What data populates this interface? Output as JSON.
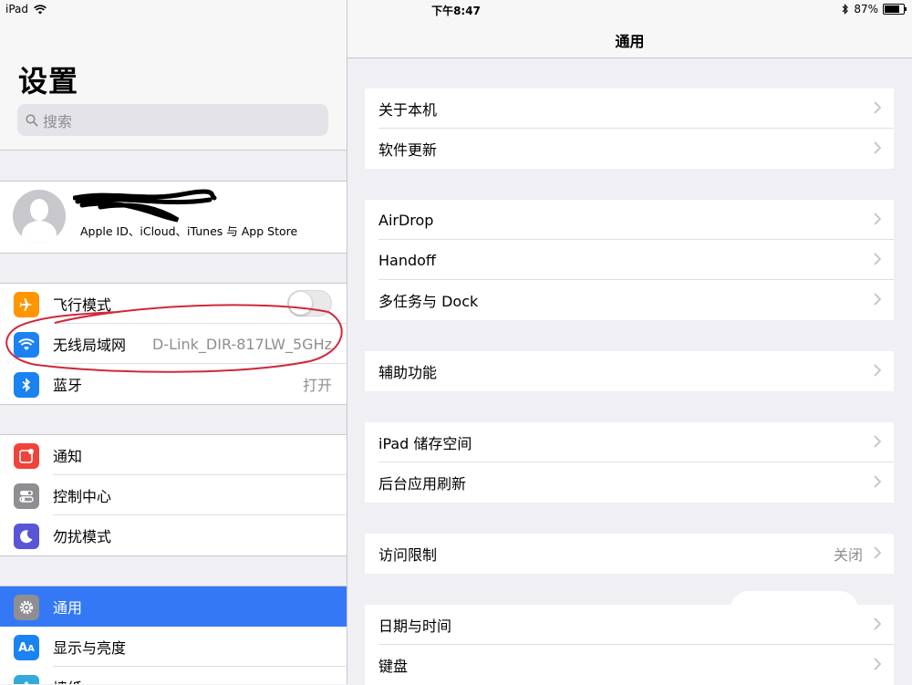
{
  "status": {
    "device": "iPad",
    "time": "下午8:47",
    "battery": "87%",
    "battery_level": 0.87
  },
  "left": {
    "title": "设置",
    "search_placeholder": "搜索",
    "profile_subtitle": "Apple ID、iCloud、iTunes 与 App Store",
    "group1": [
      {
        "label": "飞行模式",
        "value": "",
        "icon": "airplane-icon",
        "color": "#ff9500",
        "toggle": false
      },
      {
        "label": "无线局域网",
        "value": "D-Link_DIR-817LW_5GHz",
        "icon": "wifi-icon",
        "color": "#1b82f2"
      },
      {
        "label": "蓝牙",
        "value": "打开",
        "icon": "bluetooth-icon",
        "color": "#1b82f2"
      }
    ],
    "group2": [
      {
        "label": "通知",
        "icon": "notification-icon",
        "color": "#f0433a"
      },
      {
        "label": "控制中心",
        "icon": "control-center-icon",
        "color": "#8e8e93"
      },
      {
        "label": "勿扰模式",
        "icon": "moon-icon",
        "color": "#5856d6"
      }
    ],
    "group3": [
      {
        "label": "通用",
        "icon": "gear-icon",
        "color": "#8e8e93",
        "selected": true
      },
      {
        "label": "显示与亮度",
        "icon": "display-icon",
        "color": "#1b82f2"
      },
      {
        "label": "墙纸",
        "icon": "wallpaper-icon",
        "color": "#34aadc"
      }
    ]
  },
  "right": {
    "title": "通用",
    "groups": [
      [
        {
          "label": "关于本机",
          "value": ""
        },
        {
          "label": "软件更新",
          "value": ""
        }
      ],
      [
        {
          "label": "AirDrop",
          "value": ""
        },
        {
          "label": "Handoff",
          "value": ""
        },
        {
          "label": "多任务与 Dock",
          "value": ""
        }
      ],
      [
        {
          "label": "辅助功能",
          "value": ""
        }
      ],
      [
        {
          "label": "iPad 储存空间",
          "value": ""
        },
        {
          "label": "后台应用刷新",
          "value": ""
        }
      ],
      [
        {
          "label": "访问限制",
          "value": "关闭"
        }
      ],
      [
        {
          "label": "日期与时间",
          "value": ""
        },
        {
          "label": "键盘",
          "value": ""
        }
      ]
    ]
  }
}
